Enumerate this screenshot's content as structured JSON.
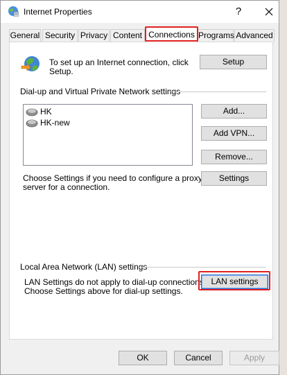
{
  "window": {
    "title": "Internet Properties",
    "help_glyph": "?"
  },
  "tabs": [
    {
      "label": "General"
    },
    {
      "label": "Security"
    },
    {
      "label": "Privacy"
    },
    {
      "label": "Content"
    },
    {
      "label": "Connections"
    },
    {
      "label": "Programs"
    },
    {
      "label": "Advanced"
    }
  ],
  "setup": {
    "text": "To set up an Internet connection, click\nSetup.",
    "button": "Setup"
  },
  "dialup": {
    "group_title": "Dial-up and Virtual Private Network settings",
    "items": [
      {
        "label": "HK"
      },
      {
        "label": "HK-new"
      }
    ],
    "add_button": "Add...",
    "add_vpn_button": "Add VPN...",
    "remove_button": "Remove...",
    "proxy_text": "Choose Settings if you need to configure a proxy\nserver for a connection.",
    "settings_button": "Settings"
  },
  "lan": {
    "group_title": "Local Area Network (LAN) settings",
    "text": "LAN Settings do not apply to dial-up connections.\nChoose Settings above for dial-up settings.",
    "button": "LAN settings"
  },
  "footer": {
    "ok": "OK",
    "cancel": "Cancel",
    "apply": "Apply"
  },
  "colors": {
    "highlight": "#e02020",
    "dialog_bg": "#f0f0f0",
    "panel_bg": "#ffffff"
  }
}
